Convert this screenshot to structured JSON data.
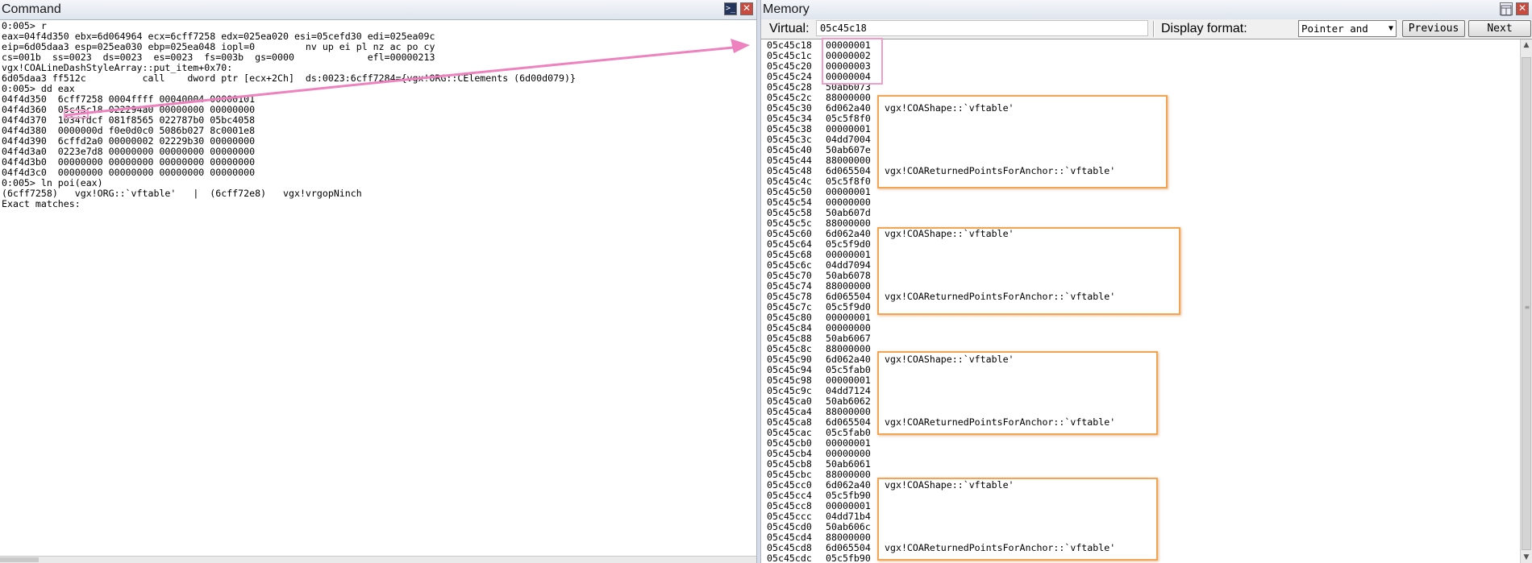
{
  "command_window": {
    "title": "Command",
    "lines": [
      "0:005> r",
      "eax=04f4d350 ebx=6d064964 ecx=6cff7258 edx=025ea020 esi=05cefd30 edi=025ea09c",
      "eip=6d05daa3 esp=025ea030 ebp=025ea048 iopl=0         nv up ei pl nz ac po cy",
      "cs=001b  ss=0023  ds=0023  es=0023  fs=003b  gs=0000             efl=00000213",
      "vgx!COALineDashStyleArray::put_item+0x70:",
      "6d05daa3 ff512c          call    dword ptr [ecx+2Ch]  ds:0023:6cff7284={vgx!ORG::CElements (6d00d079)}",
      "0:005> dd eax",
      "04f4d350  6cff7258 0004ffff 00040004 00000101",
      "04f4d360  05c45c18 022294a0 00000000 00000000",
      "04f4d370  1034fdcf 081f8565 022787b0 05bc4058",
      "04f4d380  0000000d f0e0d0c0 5086b027 8c0001e8",
      "04f4d390  6cffd2a0 00000002 02229b30 00000000",
      "04f4d3a0  0223e7d8 00000000 00000000 00000000",
      "04f4d3b0  00000000 00000000 00000000 00000000",
      "04f4d3c0  00000000 00000000 00000000 00000000",
      "0:005> ln poi(eax)",
      "(6cff7258)   vgx!ORG::`vftable'   |  (6cff72e8)   vgx!vrgopNinch",
      "Exact matches:"
    ]
  },
  "memory_window": {
    "title": "Memory",
    "virtual_label": "Virtual:",
    "virtual_value": "05c45c18",
    "display_format_label": "Display format:",
    "display_format_value": "Pointer and",
    "previous_label": "Previous",
    "next_label": "Next",
    "rows": [
      {
        "addr": "05c45c18",
        "val": "00000001",
        "sym": ""
      },
      {
        "addr": "05c45c1c",
        "val": "00000002",
        "sym": ""
      },
      {
        "addr": "05c45c20",
        "val": "00000003",
        "sym": ""
      },
      {
        "addr": "05c45c24",
        "val": "00000004",
        "sym": ""
      },
      {
        "addr": "05c45c28",
        "val": "50ab6073",
        "sym": ""
      },
      {
        "addr": "05c45c2c",
        "val": "88000000",
        "sym": ""
      },
      {
        "addr": "05c45c30",
        "val": "6d062a40",
        "sym": "vgx!COAShape::`vftable'"
      },
      {
        "addr": "05c45c34",
        "val": "05c5f8f0",
        "sym": ""
      },
      {
        "addr": "05c45c38",
        "val": "00000001",
        "sym": ""
      },
      {
        "addr": "05c45c3c",
        "val": "04dd7004",
        "sym": ""
      },
      {
        "addr": "05c45c40",
        "val": "50ab607e",
        "sym": ""
      },
      {
        "addr": "05c45c44",
        "val": "88000000",
        "sym": ""
      },
      {
        "addr": "05c45c48",
        "val": "6d065504",
        "sym": "vgx!COAReturnedPointsForAnchor::`vftable'"
      },
      {
        "addr": "05c45c4c",
        "val": "05c5f8f0",
        "sym": ""
      },
      {
        "addr": "05c45c50",
        "val": "00000001",
        "sym": ""
      },
      {
        "addr": "05c45c54",
        "val": "00000000",
        "sym": ""
      },
      {
        "addr": "05c45c58",
        "val": "50ab607d",
        "sym": ""
      },
      {
        "addr": "05c45c5c",
        "val": "88000000",
        "sym": ""
      },
      {
        "addr": "05c45c60",
        "val": "6d062a40",
        "sym": "vgx!COAShape::`vftable'"
      },
      {
        "addr": "05c45c64",
        "val": "05c5f9d0",
        "sym": ""
      },
      {
        "addr": "05c45c68",
        "val": "00000001",
        "sym": ""
      },
      {
        "addr": "05c45c6c",
        "val": "04dd7094",
        "sym": ""
      },
      {
        "addr": "05c45c70",
        "val": "50ab6078",
        "sym": ""
      },
      {
        "addr": "05c45c74",
        "val": "88000000",
        "sym": ""
      },
      {
        "addr": "05c45c78",
        "val": "6d065504",
        "sym": "vgx!COAReturnedPointsForAnchor::`vftable'"
      },
      {
        "addr": "05c45c7c",
        "val": "05c5f9d0",
        "sym": ""
      },
      {
        "addr": "05c45c80",
        "val": "00000001",
        "sym": ""
      },
      {
        "addr": "05c45c84",
        "val": "00000000",
        "sym": ""
      },
      {
        "addr": "05c45c88",
        "val": "50ab6067",
        "sym": ""
      },
      {
        "addr": "05c45c8c",
        "val": "88000000",
        "sym": ""
      },
      {
        "addr": "05c45c90",
        "val": "6d062a40",
        "sym": "vgx!COAShape::`vftable'"
      },
      {
        "addr": "05c45c94",
        "val": "05c5fab0",
        "sym": ""
      },
      {
        "addr": "05c45c98",
        "val": "00000001",
        "sym": ""
      },
      {
        "addr": "05c45c9c",
        "val": "04dd7124",
        "sym": ""
      },
      {
        "addr": "05c45ca0",
        "val": "50ab6062",
        "sym": ""
      },
      {
        "addr": "05c45ca4",
        "val": "88000000",
        "sym": ""
      },
      {
        "addr": "05c45ca8",
        "val": "6d065504",
        "sym": "vgx!COAReturnedPointsForAnchor::`vftable'"
      },
      {
        "addr": "05c45cac",
        "val": "05c5fab0",
        "sym": ""
      },
      {
        "addr": "05c45cb0",
        "val": "00000001",
        "sym": ""
      },
      {
        "addr": "05c45cb4",
        "val": "00000000",
        "sym": ""
      },
      {
        "addr": "05c45cb8",
        "val": "50ab6061",
        "sym": ""
      },
      {
        "addr": "05c45cbc",
        "val": "88000000",
        "sym": ""
      },
      {
        "addr": "05c45cc0",
        "val": "6d062a40",
        "sym": "vgx!COAShape::`vftable'"
      },
      {
        "addr": "05c45cc4",
        "val": "05c5fb90",
        "sym": ""
      },
      {
        "addr": "05c45cc8",
        "val": "00000001",
        "sym": ""
      },
      {
        "addr": "05c45ccc",
        "val": "04dd71b4",
        "sym": ""
      },
      {
        "addr": "05c45cd0",
        "val": "50ab606c",
        "sym": ""
      },
      {
        "addr": "05c45cd4",
        "val": "88000000",
        "sym": ""
      },
      {
        "addr": "05c45cd8",
        "val": "6d065504",
        "sym": "vgx!COAReturnedPointsForAnchor::`vftable'"
      },
      {
        "addr": "05c45cdc",
        "val": "05c5fb90",
        "sym": ""
      }
    ]
  },
  "colors": {
    "highlight_orange": "#f3a452",
    "highlight_pink": "#ee9ec9",
    "arrow_pink": "#ee82bf"
  }
}
